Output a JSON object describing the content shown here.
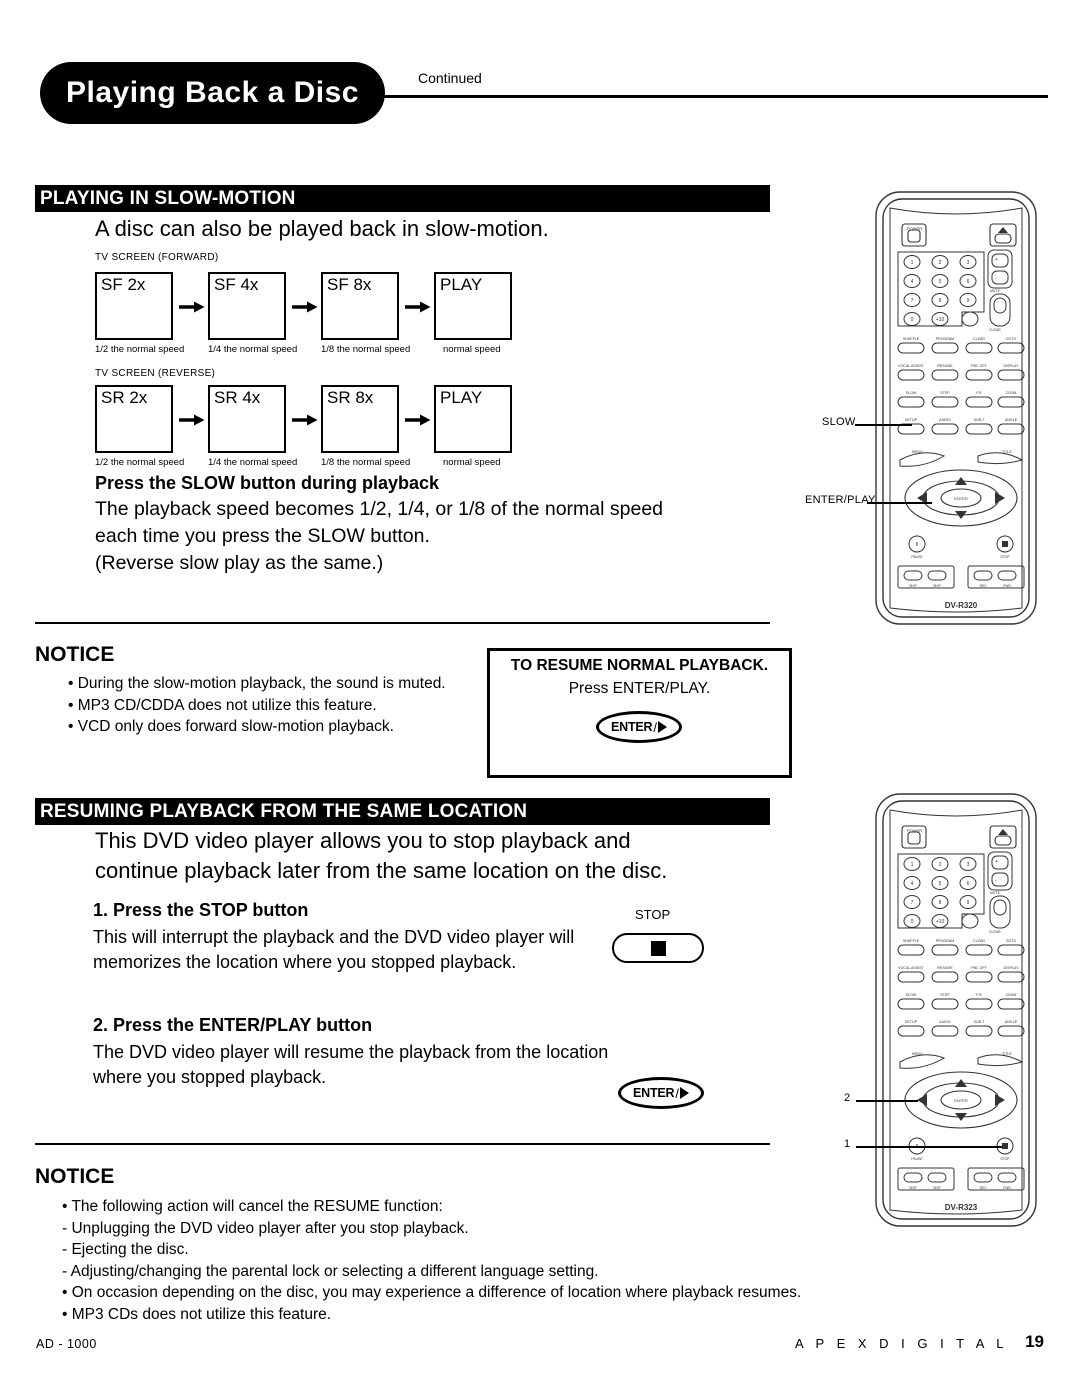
{
  "header": {
    "title": "Playing Back a Disc",
    "continued": "Continued"
  },
  "slow_motion": {
    "section_title": "PLAYING IN SLOW-MOTION",
    "lead": "A disc can also be played back in slow-motion.",
    "forward_label": "TV SCREEN (FORWARD)",
    "reverse_label": "TV SCREEN (REVERSE)",
    "forward_steps": [
      {
        "box": "SF 2x",
        "caption": "1/2 the normal speed"
      },
      {
        "box": "SF 4x",
        "caption": "1/4 the normal speed"
      },
      {
        "box": "SF 8x",
        "caption": "1/8 the normal speed"
      },
      {
        "box": "PLAY",
        "caption": "normal speed"
      }
    ],
    "reverse_steps": [
      {
        "box": "SR 2x",
        "caption": "1/2 the normal speed"
      },
      {
        "box": "SR 4x",
        "caption": "1/4 the normal speed"
      },
      {
        "box": "SR 8x",
        "caption": "1/8 the normal speed"
      },
      {
        "box": "PLAY",
        "caption": "normal speed"
      }
    ],
    "instruction_heading": "Press the SLOW button during playback",
    "instruction_lines": [
      "The playback speed becomes 1/2, 1/4, or 1/8 of the normal speed",
      "each time you press the SLOW button.",
      "(Reverse slow play as the same.)"
    ]
  },
  "notice_slow": {
    "title": "NOTICE",
    "items": [
      "• During the slow-motion playback, the sound is muted.",
      "• MP3 CD/CDDA does not utilize this feature.",
      "• VCD only does forward slow-motion playback."
    ]
  },
  "resume_box": {
    "title": "TO RESUME NORMAL PLAYBACK.",
    "subtitle": "Press ENTER/PLAY.",
    "button_text": "ENTER",
    "button_slash": "/"
  },
  "resuming": {
    "section_title": "RESUMING PLAYBACK FROM THE SAME LOCATION",
    "lead_lines": [
      "This DVD video player allows you to stop playback and",
      "continue playback later from the same location on the disc."
    ],
    "step1_heading": "1. Press the STOP button",
    "step1_lines": [
      "This will interrupt the playback and the DVD video player will",
      "memorizes the location where you stopped playback."
    ],
    "stop_button_label": "STOP",
    "step2_heading": "2. Press the ENTER/PLAY button",
    "step2_lines": [
      "The DVD video player will resume the playback from the location",
      "where you stopped playback."
    ],
    "enter_button_text": "ENTER",
    "enter_button_slash": "/"
  },
  "notice_resume": {
    "title": "NOTICE",
    "items": [
      "• The following action will cancel the RESUME function:",
      "- Unplugging the DVD video player after you stop playback.",
      "- Ejecting the disc.",
      "- Adjusting/changing the parental lock or selecting a different language setting.",
      "• On occasion depending on the disc, you may experience a difference of location where playback resumes.",
      "• MP3 CDs does not utilize this feature."
    ]
  },
  "remote_top": {
    "callout_slow": "SLOW",
    "callout_enter": "ENTER/PLAY",
    "model": "DV-R320",
    "keypad": [
      "1",
      "2",
      "3",
      "4",
      "5",
      "6",
      "7",
      "8",
      "9",
      "0",
      "+10"
    ],
    "button_rows": [
      [
        "SHUFFLE",
        "PROGRAM",
        "CLEAR",
        "GOTO"
      ],
      [
        "VOCAL ASSIST",
        "RESUME",
        "PBC OFF",
        "DISPLAY"
      ],
      [
        "SLOW",
        "STEP",
        "F.R",
        "ZOOM"
      ],
      [
        "SETUP",
        "AUDIO",
        "SUB-T",
        "ANGLE"
      ]
    ],
    "power_label": "POWER",
    "vol_label": "VOL",
    "mute_label": "MUTE",
    "menu_label": "MENU",
    "title_label": "TITLE",
    "enter_center": "ENTER",
    "pause_label": "PAUSE",
    "stop_label": "STOP"
  },
  "remote_bottom": {
    "callout_1": "1",
    "callout_2": "2",
    "model": "DV-R323"
  },
  "footer": {
    "left": "AD - 1000",
    "brand": "A P E X    D I G I T A L",
    "page": "19"
  }
}
